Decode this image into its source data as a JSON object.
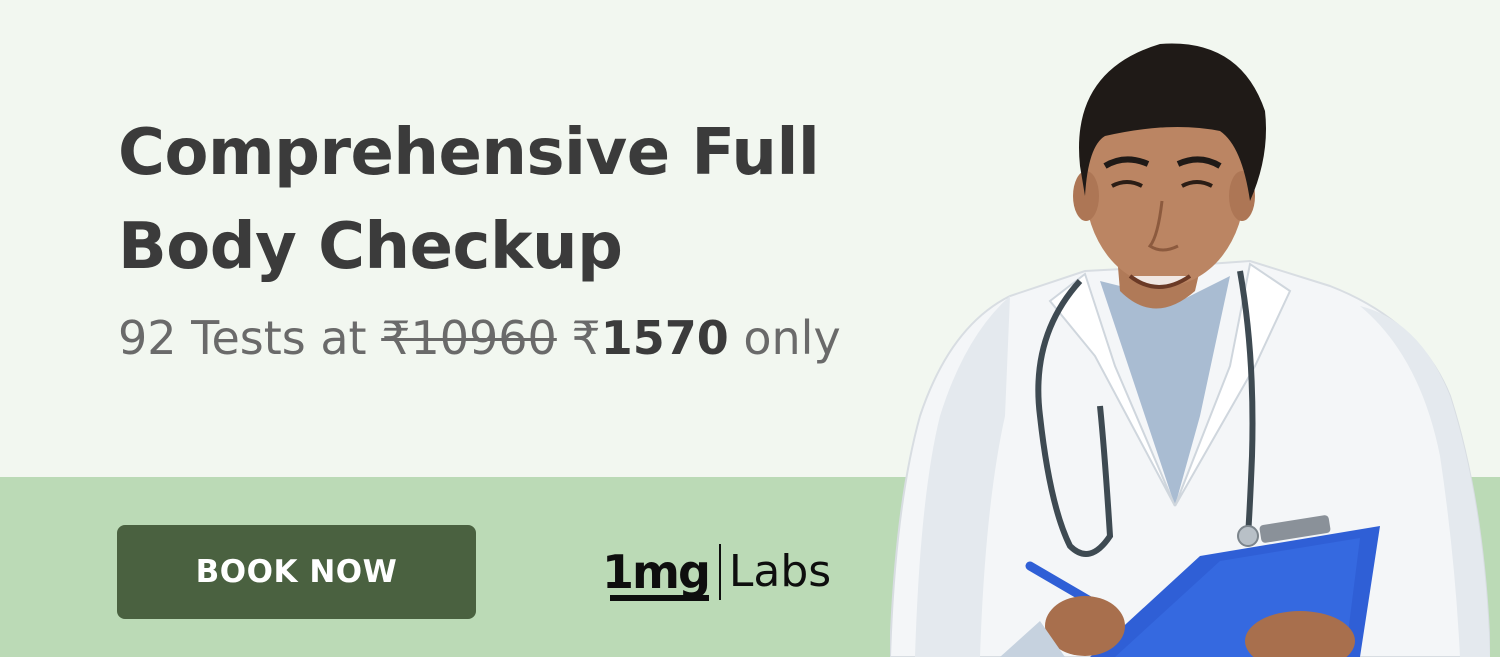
{
  "banner": {
    "headline_line1": "Comprehensive Full",
    "headline_line2": "Body Checkup",
    "price": {
      "prefix": "92 Tests at",
      "old_price": "₹10960",
      "currency": "₹",
      "new_amount": "1570",
      "suffix": "only"
    },
    "cta_label": "BOOK NOW",
    "logo": {
      "mark": "1mg",
      "name": "Labs"
    }
  },
  "colors": {
    "background": "#f2f7f0",
    "band": "#bbdab6",
    "button": "#4a6140",
    "headline": "#3b3b3b",
    "subtext": "#6a6a6a"
  },
  "image": {
    "icon": "doctor-with-clipboard-icon"
  }
}
